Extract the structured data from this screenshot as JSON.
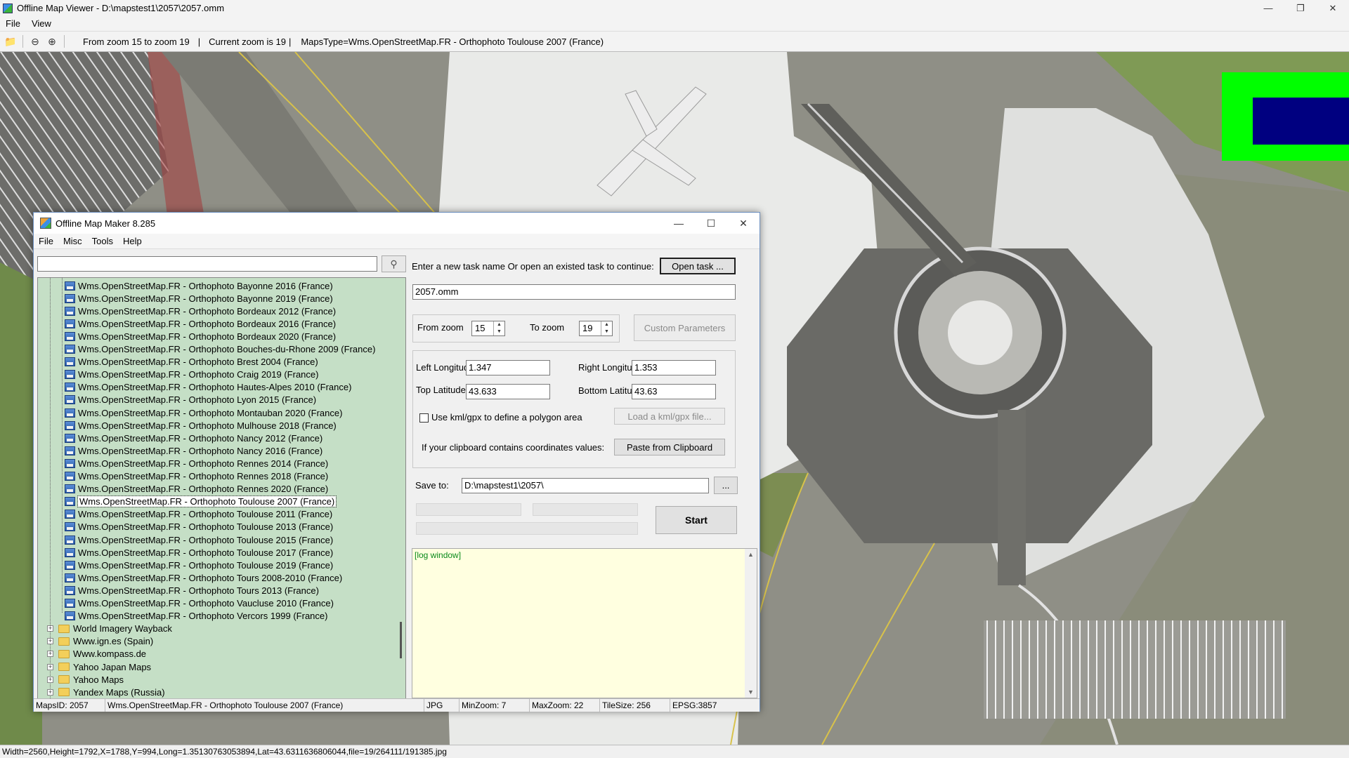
{
  "viewer": {
    "title": "Offline Map Viewer - D:\\mapstest1\\2057\\2057.omm",
    "menu": [
      "File",
      "View"
    ],
    "toolbar": {
      "zoom_range": "From zoom 15 to zoom 19",
      "separator": "|",
      "current_zoom": "Current zoom is 19",
      "maps_type": "MapsType=Wms.OpenStreetMap.FR - Orthophoto Toulouse 2007 (France)"
    },
    "status": "Width=2560,Height=1792,X=1788,Y=994,Long=1.35130763053894,Lat=43.6311636806044,file=19/264111/191385.jpg",
    "colors": {
      "overlay_outer": "#00ff00",
      "overlay_inner": "#000080"
    }
  },
  "dialog": {
    "title": "Offline Map Maker 8.285",
    "menu": [
      "File",
      "Misc",
      "Tools",
      "Help"
    ],
    "search": {
      "value": "",
      "placeholder": ""
    },
    "tree": {
      "selected_index": 17,
      "map_items": [
        "Wms.OpenStreetMap.FR - Orthophoto Bayonne 2016 (France)",
        "Wms.OpenStreetMap.FR - Orthophoto Bayonne 2019 (France)",
        "Wms.OpenStreetMap.FR - Orthophoto Bordeaux 2012 (France)",
        "Wms.OpenStreetMap.FR - Orthophoto Bordeaux 2016 (France)",
        "Wms.OpenStreetMap.FR - Orthophoto Bordeaux 2020 (France)",
        "Wms.OpenStreetMap.FR - Orthophoto Bouches-du-Rhone 2009 (France)",
        "Wms.OpenStreetMap.FR - Orthophoto Brest 2004 (France)",
        "Wms.OpenStreetMap.FR - Orthophoto Craig 2019 (France)",
        "Wms.OpenStreetMap.FR - Orthophoto Hautes-Alpes 2010 (France)",
        "Wms.OpenStreetMap.FR - Orthophoto Lyon 2015 (France)",
        "Wms.OpenStreetMap.FR - Orthophoto Montauban 2020 (France)",
        "Wms.OpenStreetMap.FR - Orthophoto Mulhouse 2018 (France)",
        "Wms.OpenStreetMap.FR - Orthophoto Nancy 2012 (France)",
        "Wms.OpenStreetMap.FR - Orthophoto Nancy 2016 (France)",
        "Wms.OpenStreetMap.FR - Orthophoto Rennes 2014 (France)",
        "Wms.OpenStreetMap.FR - Orthophoto Rennes 2018 (France)",
        "Wms.OpenStreetMap.FR - Orthophoto Rennes 2020 (France)",
        "Wms.OpenStreetMap.FR - Orthophoto Toulouse 2007 (France)",
        "Wms.OpenStreetMap.FR - Orthophoto Toulouse 2011 (France)",
        "Wms.OpenStreetMap.FR - Orthophoto Toulouse 2013 (France)",
        "Wms.OpenStreetMap.FR - Orthophoto Toulouse 2015 (France)",
        "Wms.OpenStreetMap.FR - Orthophoto Toulouse 2017 (France)",
        "Wms.OpenStreetMap.FR - Orthophoto Toulouse 2019 (France)",
        "Wms.OpenStreetMap.FR - Orthophoto Tours 2008-2010 (France)",
        "Wms.OpenStreetMap.FR - Orthophoto Tours 2013 (France)",
        "Wms.OpenStreetMap.FR - Orthophoto Vaucluse 2010 (France)",
        "Wms.OpenStreetMap.FR - Orthophoto Vercors 1999 (France)"
      ],
      "folders": [
        "World Imagery Wayback",
        "Www.ign.es (Spain)",
        "Www.kompass.de",
        "Yahoo Japan Maps",
        "Yahoo Maps",
        "Yandex Maps (Russia)"
      ]
    },
    "task": {
      "prompt": "Enter a new task name Or open an existed task to continue:",
      "open_button": "Open task ...",
      "name_value": "2057.omm"
    },
    "zoom": {
      "from_label": "From zoom",
      "from_value": "15",
      "to_label": "To zoom",
      "to_value": "19",
      "custom_button": "Custom Parameters"
    },
    "coords": {
      "left_lon_label": "Left Longitude",
      "left_lon_value": "1.347",
      "right_lon_label": "Right Longitude",
      "right_lon_value": "1.353",
      "top_lat_label": "Top Latitude",
      "top_lat_value": "43.633",
      "bottom_lat_label": "Bottom Latitude",
      "bottom_lat_value": "43.63",
      "kml_checkbox_label": "Use kml/gpx to define a polygon area",
      "kml_checked": false,
      "kml_button": "Load a kml/gpx file...",
      "clipboard_label": "If your clipboard contains coordinates values:",
      "clipboard_button": "Paste from Clipboard"
    },
    "save": {
      "label": "Save to:",
      "path": "D:\\mapstest1\\2057\\",
      "browse_button": "...",
      "start_button": "Start"
    },
    "log": {
      "text": "[log window]"
    },
    "status": {
      "maps_id": "MapsID: 2057",
      "map_name": "Wms.OpenStreetMap.FR - Orthophoto Toulouse 2007 (France)",
      "format": "JPG",
      "min_zoom": "MinZoom: 7",
      "max_zoom": "MaxZoom: 22",
      "tile_size": "TileSize: 256",
      "epsg": "EPSG:3857"
    }
  }
}
